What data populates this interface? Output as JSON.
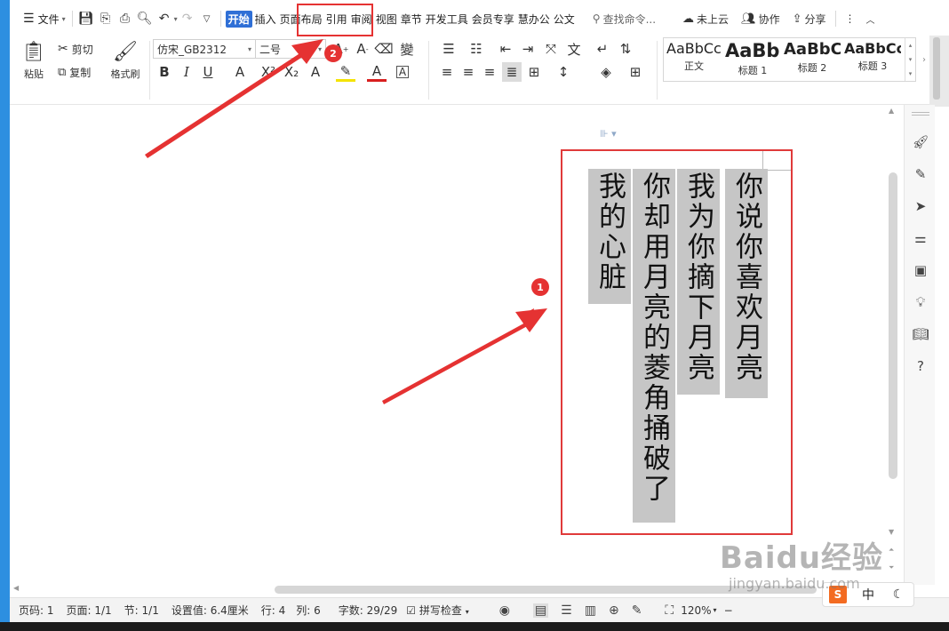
{
  "menubar": {
    "file_label": "文件",
    "tabs": [
      "开始",
      "插入",
      "页面布局",
      "引用",
      "审阅",
      "视图",
      "章节",
      "开发工具",
      "会员专享",
      "慧办公",
      "公文"
    ],
    "active_tab": "开始",
    "search_placeholder": "查找命令...",
    "cloud_label": "未上云",
    "collab_label": "协作",
    "share_label": "分享"
  },
  "ribbon": {
    "paste_label": "粘贴",
    "cut_label": "剪切",
    "copy_label": "复制",
    "format_painter_label": "格式刷",
    "font_name": "仿宋_GB2312",
    "font_size": "二号",
    "styles": [
      {
        "preview": "AaBbCcD",
        "name": "正文"
      },
      {
        "preview": "AaBb",
        "name": "标题 1"
      },
      {
        "preview": "AaBbC",
        "name": "标题 2"
      },
      {
        "preview": "AaBbCc",
        "name": "标题 3"
      }
    ]
  },
  "document": {
    "columns": [
      "你说你喜欢月亮",
      "我为你摘下月亮",
      "你却用月亮的菱角捅破了",
      "我的心脏"
    ]
  },
  "annotations": {
    "badge1": "1",
    "badge2": "2"
  },
  "statusbar": {
    "page_num": "页码: 1",
    "page_count": "页面: 1/1",
    "section": "节: 1/1",
    "setting": "设置值: 6.4厘米",
    "row": "行: 4",
    "col": "列: 6",
    "word_count": "字数: 29/29",
    "spell_check": "拼写检查",
    "zoom": "120%"
  },
  "ime": {
    "mode": "中"
  },
  "watermark": {
    "line1": "Baidu经验",
    "line2": "jingyan.baidu.com"
  },
  "colors": {
    "accent": "#2f6fd6",
    "annotation_red": "#e53232",
    "text_highlight": "#c6c6c6"
  }
}
